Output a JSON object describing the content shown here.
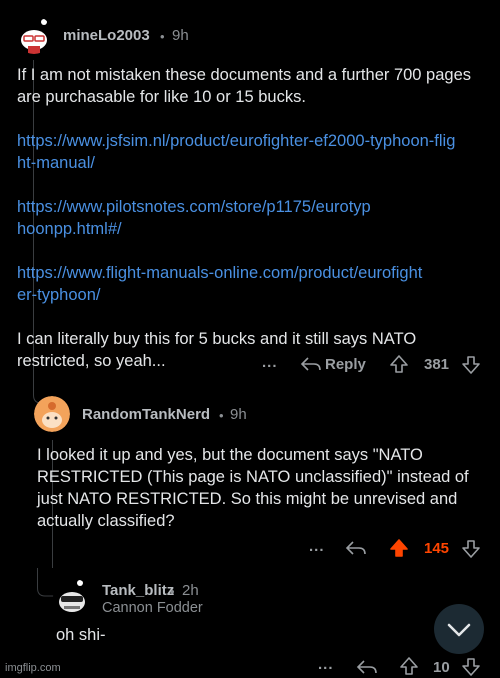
{
  "comments": [
    {
      "username": "mineLo2003",
      "time": "9h",
      "paragraphs": [
        "If I am not mistaken these documents and a further 700 pages are purchasable for like 10 or 15 bucks."
      ],
      "links": [
        "https://www.jsfsim.nl/product/eurofighter-ef2000-typhoon-flight-manual/",
        "https://www.pilotsnotes.com/store/p1175/eurotyphoonpp.html#/",
        "https://www.flight-manuals-online.com/product/eurofighter-typhoon/"
      ],
      "closing": "I can literally buy this for 5 bucks and it still says NATO restricted, so yeah...",
      "more": "...",
      "reply_label": "Reply",
      "score": "381"
    },
    {
      "username": "RandomTankNerd",
      "time": "9h",
      "text": "I looked it up and yes, but the document says \"NATO RESTRICTED (This page is NATO unclassified)\" instead of just NATO RESTRICTED. So this might be unrevised and actually classified?",
      "more": "...",
      "score": "145",
      "upvoted": true,
      "score_color": "#ff4500"
    },
    {
      "username": "Tank_blitz",
      "time": "2h",
      "flair": "Cannon Fodder",
      "text": "oh shi-",
      "more": "...",
      "score": "10"
    }
  ],
  "watermark": "imgflip.com",
  "separator": "•"
}
